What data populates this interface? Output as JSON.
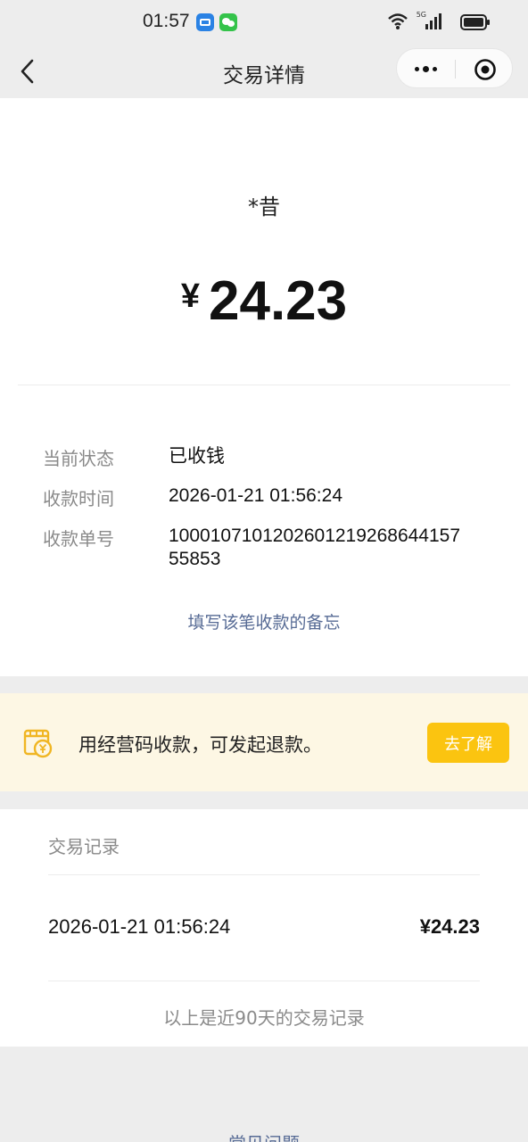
{
  "status_bar": {
    "time": "01:57",
    "network": "5G"
  },
  "nav": {
    "title": "交易详情"
  },
  "transaction": {
    "payer_name": "*昔",
    "currency_symbol": "¥",
    "amount": "24.23",
    "status_label": "当前状态",
    "status_value": "已收钱",
    "time_label": "收款时间",
    "time_value": "2026-01-21 01:56:24",
    "order_label": "收款单号",
    "order_value": "100010710120260121926864415755853",
    "memo_link": "填写该笔收款的备忘"
  },
  "banner": {
    "text": "用经营码收款，可发起退款。",
    "button_label": "去了解"
  },
  "records": {
    "title": "交易记录",
    "items": [
      {
        "time": "2026-01-21 01:56:24",
        "amount": "¥24.23"
      }
    ],
    "footer": "以上是近90天的交易记录"
  },
  "bottom": {
    "link": "常见问题"
  },
  "colors": {
    "background": "#ededed",
    "link": "#576b95",
    "accent_yellow": "#fbc410",
    "banner_bg": "#fdf7e4"
  }
}
